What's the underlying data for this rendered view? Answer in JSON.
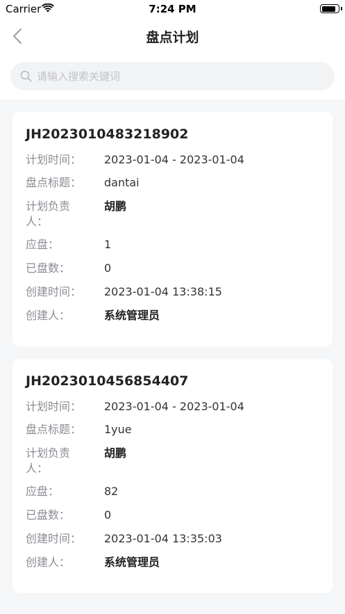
{
  "status_bar": {
    "carrier": "Carrier",
    "time": "7:24 PM"
  },
  "nav": {
    "title": "盘点计划"
  },
  "search": {
    "placeholder": "请输入搜索关键词"
  },
  "labels": {
    "plan_time": "计划时间：",
    "title": "盘点标题：",
    "owner": "计划负责人：",
    "should": "应盘：",
    "done": "已盘数：",
    "created_time": "创建时间：",
    "creator": "创建人："
  },
  "plans": [
    {
      "id": "JH2023010483218902",
      "plan_time": "2023-01-04 - 2023-01-04",
      "title": "dantai",
      "owner": "胡鹏",
      "should": "1",
      "done": "0",
      "created_time": "2023-01-04 13:38:15",
      "creator": "系统管理员"
    },
    {
      "id": "JH2023010456854407",
      "plan_time": "2023-01-04 - 2023-01-04",
      "title": "1yue",
      "owner": "胡鹏",
      "should": "82",
      "done": "0",
      "created_time": "2023-01-04 13:35:03",
      "creator": "系统管理员"
    }
  ]
}
